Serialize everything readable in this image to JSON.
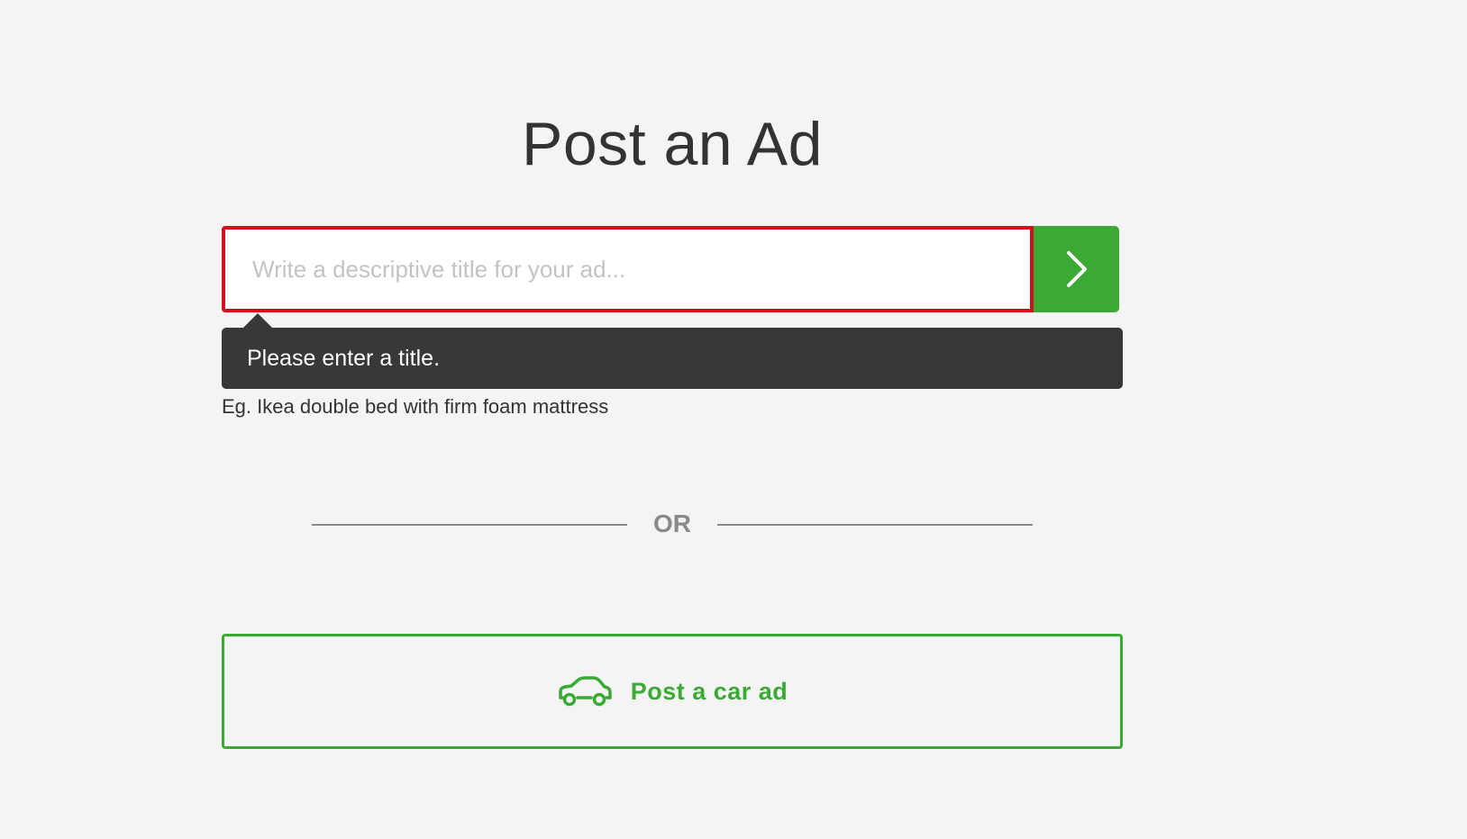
{
  "page": {
    "title": "Post an Ad"
  },
  "title_form": {
    "input_value": "",
    "input_placeholder": "Write a descriptive title for your ad...",
    "next_button_icon": "chevron-right-icon",
    "error_tooltip": "Please enter a title.",
    "hint": "Eg. Ikea double bed with firm foam mattress"
  },
  "divider": {
    "label": "OR"
  },
  "car_ad": {
    "label": "Post a car ad",
    "icon": "car-icon"
  },
  "colors": {
    "accent_green": "#3aaa35",
    "error_red": "#d0111b",
    "tooltip_bg": "#383838",
    "background": "#f4f4f4"
  }
}
